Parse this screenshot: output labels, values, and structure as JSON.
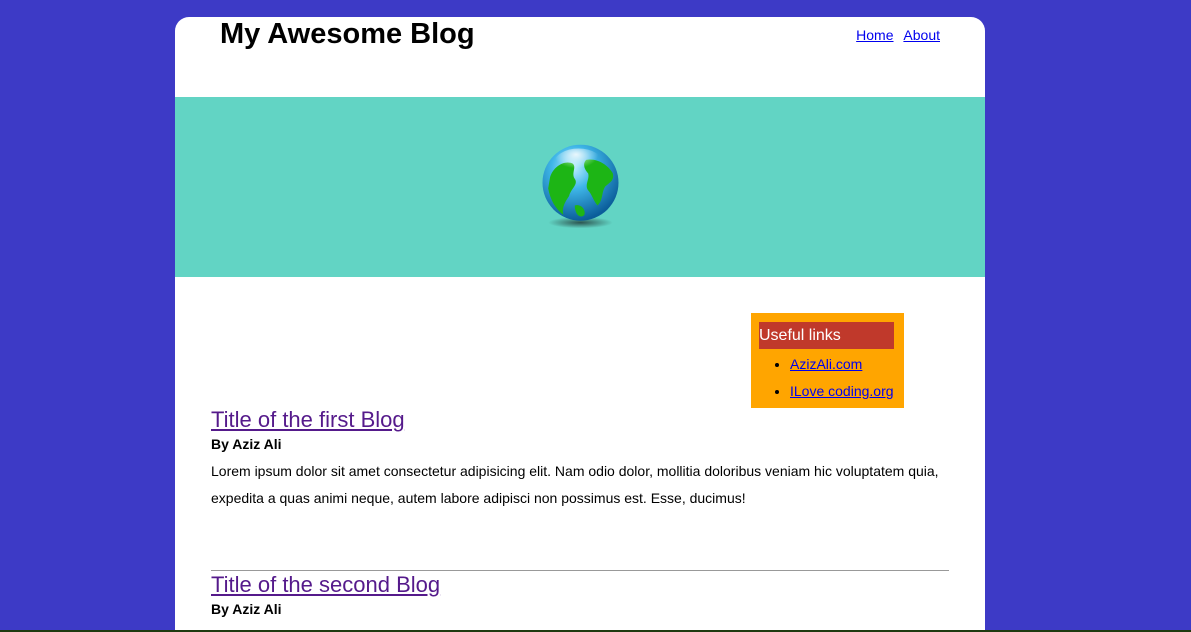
{
  "site": {
    "title": "My Awesome Blog"
  },
  "nav": {
    "links": [
      "Home",
      "About"
    ]
  },
  "banner": {
    "icon": "globe-icon"
  },
  "sidebar": {
    "title": "Useful links",
    "links": [
      "AzizAli.com",
      "ILove coding.org"
    ]
  },
  "posts": [
    {
      "title": "Title of the first Blog",
      "author": "By Aziz Ali",
      "body": "Lorem ipsum dolor sit amet consectetur adipisicing elit. Nam odio dolor, mollitia doloribus veniam hic voluptatem quia, expedita a quas animi neque, autem labore adipisci non possimus est. Esse, ducimus!"
    },
    {
      "title": "Title of the second Blog",
      "author": "By Aziz Ali"
    }
  ],
  "colors": {
    "background": "#3d3ac6",
    "banner": "#62d4c4",
    "sidebar": "#ffa500",
    "sidebar_title": "#c0392b",
    "post_title": "#551a8b",
    "link": "#0000ee"
  }
}
